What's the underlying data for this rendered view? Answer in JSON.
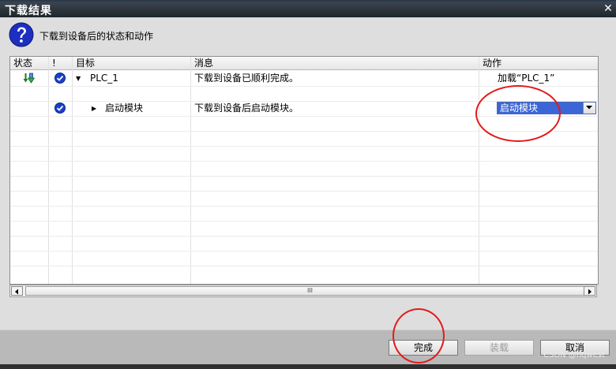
{
  "dialog": {
    "title": "下载结果",
    "close_glyph": "✕",
    "header_text": "下载到设备后的状态和动作"
  },
  "table": {
    "columns": [
      "状态",
      "!",
      "目标",
      "消息",
      "动作"
    ],
    "rows": [
      {
        "expander": "▼",
        "target": "PLC_1",
        "message": "下载到设备已顺利完成。",
        "action": "加载“PLC_1”"
      },
      {
        "expander": "▶",
        "target": "启动模块",
        "message": "下载到设备后启动模块。",
        "action": "启动模块"
      }
    ],
    "scroll_grip": "III"
  },
  "footer": {
    "finish_label": "完成",
    "load_label": "装载",
    "cancel_label": "取消",
    "load_disabled": true
  },
  "watermark": "CSDN @hqwest",
  "icons": [
    "question-icon",
    "download-status-icon",
    "check-icon",
    "expand-arrow-icon",
    "dropdown-arrow-icon",
    "close-icon"
  ],
  "colors": {
    "titlebar": "#2a333c",
    "check": "#1a3fc8",
    "selection": "#3b66d8",
    "annotation": "#e21a1a"
  }
}
